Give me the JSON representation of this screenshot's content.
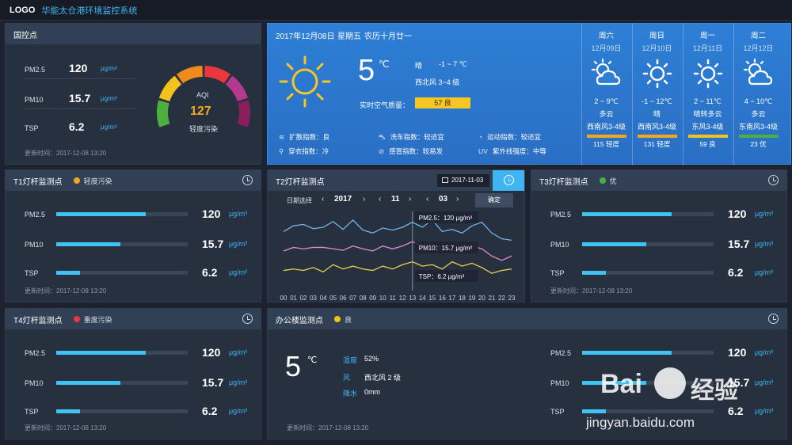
{
  "topbar": {
    "logo": "LOGO",
    "title": "华能太仓港环境监控系统"
  },
  "national": {
    "title": "国控点",
    "rows": [
      {
        "label": "PM2.5",
        "value": "120",
        "unit": "μg/m³"
      },
      {
        "label": "PM10",
        "value": "15.7",
        "unit": "μg/m³"
      },
      {
        "label": "TSP",
        "value": "6.2",
        "unit": "μg/m³"
      }
    ],
    "aqi_label": "AQI",
    "aqi_value": "127",
    "aqi_status": "轻度污染",
    "updated": "更新时间：2017-12-08 13:20",
    "gauge_colors": [
      "#4caf3f",
      "#f2c21d",
      "#f08a1b",
      "#e8383d",
      "#b43a8f",
      "#8a1e5c"
    ]
  },
  "weather": {
    "date": "2017年12月08日",
    "weekday": "星期五",
    "lunar": "农历十月廿一",
    "temp": "5",
    "temp_unit": "℃",
    "cond": "晴",
    "range": "-1 ~ 7 ℃",
    "wind": "西北风 3~4 级",
    "aqi_label": "实时空气质量：",
    "aqi_badge": "57 良",
    "indices": [
      {
        "icon": "≋",
        "label": "扩散指数：良"
      },
      {
        "icon": "⛍",
        "label": "洗车指数：较适宜"
      },
      {
        "icon": "◔",
        "label": "运动指数：较适宜"
      },
      {
        "icon": "⚲",
        "label": "穿衣指数：冷"
      },
      {
        "icon": "⊘",
        "label": "感冒指数：较易发"
      },
      {
        "icon": "UV",
        "label": "紫外线强度：中等"
      }
    ],
    "forecast": [
      {
        "day": "周六",
        "date": "12月09日",
        "icon": "cloud-sun",
        "temp": "2 ~ 9℃",
        "cond": "多云",
        "wind": "西南风3-4级",
        "color": "#f2a81d",
        "aqi": "115 轻度"
      },
      {
        "day": "周日",
        "date": "12月10日",
        "icon": "sun",
        "temp": "-1 ~ 12℃",
        "cond": "晴",
        "wind": "西南风3-4级",
        "color": "#f2a81d",
        "aqi": "131 轻度"
      },
      {
        "day": "周一",
        "date": "12月11日",
        "icon": "sun",
        "temp": "2 ~ 11℃",
        "cond": "晴转多云",
        "wind": "东风3-4级",
        "color": "#f2c21d",
        "aqi": "59 良"
      },
      {
        "day": "周二",
        "date": "12月12日",
        "icon": "cloud-sun",
        "temp": "4 ~ 10℃",
        "cond": "多云",
        "wind": "东南风3-4级",
        "color": "#4caf3f",
        "aqi": "23 优"
      }
    ]
  },
  "t1": {
    "title": "T1灯杆监测点",
    "status": "轻度污染",
    "status_color": "#f2a81d",
    "rows": [
      {
        "label": "PM2.5",
        "value": "120",
        "unit": "μg/m³",
        "fill": 0.68
      },
      {
        "label": "PM10",
        "value": "15.7",
        "unit": "μg/m³",
        "fill": 0.49
      },
      {
        "label": "TSP",
        "value": "6.2",
        "unit": "μg/m³",
        "fill": 0.18
      }
    ],
    "updated": "更新时间：2017-12-08 13:20"
  },
  "t2": {
    "title": "T2灯杆监测点",
    "date": "2017-11-03",
    "date_select": "日期选择",
    "year": "2017",
    "month": "11",
    "day": "03",
    "confirm": "确定",
    "tips": [
      "PM2.5：120 μg/m³",
      "PM10：15.7 μg/m³",
      "TSP：6.2 μg/m³"
    ]
  },
  "t3": {
    "title": "T3灯杆监测点",
    "status": "优",
    "status_color": "#4caf3f",
    "rows": [
      {
        "label": "PM2.5",
        "value": "120",
        "unit": "μg/m³",
        "fill": 0.68
      },
      {
        "label": "PM10",
        "value": "15.7",
        "unit": "μg/m³",
        "fill": 0.49
      },
      {
        "label": "TSP",
        "value": "6.2",
        "unit": "μg/m³",
        "fill": 0.18
      }
    ],
    "updated": "更新时间：2017-12-08 13:20"
  },
  "t4": {
    "title": "T4灯杆监测点",
    "status": "重度污染",
    "status_color": "#e8383d",
    "rows": [
      {
        "label": "PM2.5",
        "value": "120",
        "unit": "μg/m³",
        "fill": 0.68
      },
      {
        "label": "PM10",
        "value": "15.7",
        "unit": "μg/m³",
        "fill": 0.49
      },
      {
        "label": "TSP",
        "value": "6.2",
        "unit": "μg/m³",
        "fill": 0.18
      }
    ],
    "updated": "更新时间：2017-12-08 13:20"
  },
  "office": {
    "title": "办公楼监测点",
    "status": "良",
    "status_color": "#f2c21d",
    "temp": "5",
    "temp_unit": "℃",
    "humidity_label": "湿度",
    "humidity": "52%",
    "wind_label": "风",
    "wind": "西北风 2 级",
    "rain_label": "降水",
    "rain": "0mm",
    "rows": [
      {
        "label": "PM2.5",
        "value": "120",
        "unit": "μg/m³",
        "fill": 0.68
      },
      {
        "label": "PM10",
        "value": "15.7",
        "unit": "μg/m³",
        "fill": 0.49
      },
      {
        "label": "TSP",
        "value": "6.2",
        "unit": "μg/m³",
        "fill": 0.18
      }
    ],
    "updated": "更新时间：2017-12-08 13:20"
  },
  "watermark": {
    "text1": "Bai",
    "text2": "经验",
    "url": "jingyan.baidu.com"
  },
  "chart_data": {
    "type": "line",
    "x": [
      "00",
      "01",
      "02",
      "03",
      "04",
      "05",
      "06",
      "07",
      "08",
      "09",
      "10",
      "11",
      "12",
      "13",
      "14",
      "15",
      "16",
      "17",
      "18",
      "19",
      "20",
      "21",
      "22",
      "23"
    ],
    "series": [
      {
        "color": "#6fb6e8",
        "values": [
          82,
          90,
          92,
          86,
          88,
          96,
          85,
          98,
          84,
          80,
          87,
          84,
          88,
          95,
          88,
          98,
          82,
          85,
          80,
          90,
          95,
          80,
          72,
          70
        ]
      },
      {
        "color": "#e88ad0",
        "values": [
          55,
          60,
          58,
          60,
          60,
          58,
          56,
          62,
          58,
          55,
          62,
          58,
          62,
          68,
          62,
          64,
          58,
          56,
          55,
          62,
          58,
          48,
          42,
          48
        ]
      },
      {
        "color": "#e8d14a",
        "values": [
          28,
          30,
          28,
          32,
          26,
          36,
          30,
          34,
          30,
          28,
          34,
          30,
          36,
          40,
          34,
          36,
          30,
          40,
          34,
          38,
          32,
          24,
          28,
          30
        ]
      }
    ],
    "cursor_index": 13
  }
}
